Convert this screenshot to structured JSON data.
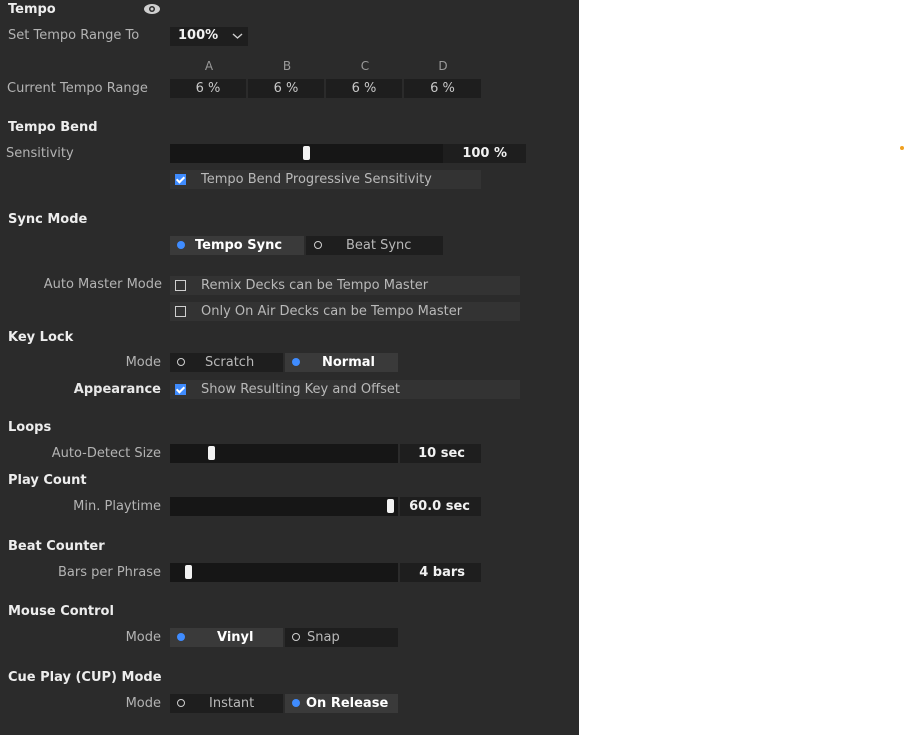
{
  "tempo": {
    "title": "Tempo",
    "set_range_label": "Set Tempo Range To",
    "set_range_value": "100%",
    "deck_headers": [
      "A",
      "B",
      "C",
      "D"
    ],
    "current_range_label": "Current Tempo Range",
    "current_range_values": [
      "6 %",
      "6 %",
      "6 %",
      "6 %"
    ]
  },
  "tempo_bend": {
    "title": "Tempo Bend",
    "sensitivity_label": "Sensitivity",
    "sensitivity_value": "100 %",
    "sensitivity_level": 0.5,
    "progressive_label": "Tempo Bend Progressive Sensitivity",
    "progressive_checked": true
  },
  "sync_mode": {
    "title": "Sync Mode",
    "options": [
      "Tempo Sync",
      "Beat Sync"
    ],
    "selected": "Tempo Sync",
    "auto_master_label": "Auto Master Mode",
    "remix_label": "Remix Decks can be Tempo Master",
    "remix_checked": false,
    "onair_label": "Only On Air Decks can be Tempo Master",
    "onair_checked": false
  },
  "key_lock": {
    "title": "Key Lock",
    "mode_label": "Mode",
    "options": [
      "Scratch",
      "Normal"
    ],
    "selected": "Normal",
    "appearance_label": "Appearance",
    "show_key_label": "Show Resulting Key and Offset",
    "show_key_checked": true
  },
  "loops": {
    "title": "Loops",
    "auto_detect_label": "Auto-Detect Size",
    "auto_detect_value": "10 sec",
    "auto_detect_level": 0.17
  },
  "play_count": {
    "title": "Play Count",
    "min_playtime_label": "Min. Playtime",
    "min_playtime_value": "60.0 sec",
    "min_playtime_level": 0.98
  },
  "beat_counter": {
    "title": "Beat Counter",
    "bars_label": "Bars per Phrase",
    "bars_value": "4 bars",
    "bars_level": 0.07
  },
  "mouse_control": {
    "title": "Mouse Control",
    "mode_label": "Mode",
    "options": [
      "Vinyl",
      "Snap"
    ],
    "selected": "Vinyl"
  },
  "cue_play": {
    "title": "Cue Play (CUP) Mode",
    "mode_label": "Mode",
    "options": [
      "Instant",
      "On Release"
    ],
    "selected": "On Release"
  },
  "colors": {
    "panel_bg": "#2b2b2b",
    "accent": "#3f8cff",
    "marker": "#f0a020"
  },
  "icons": [
    "eye-icon",
    "chevron-down-icon",
    "checkbox-icon",
    "radio-icon"
  ]
}
